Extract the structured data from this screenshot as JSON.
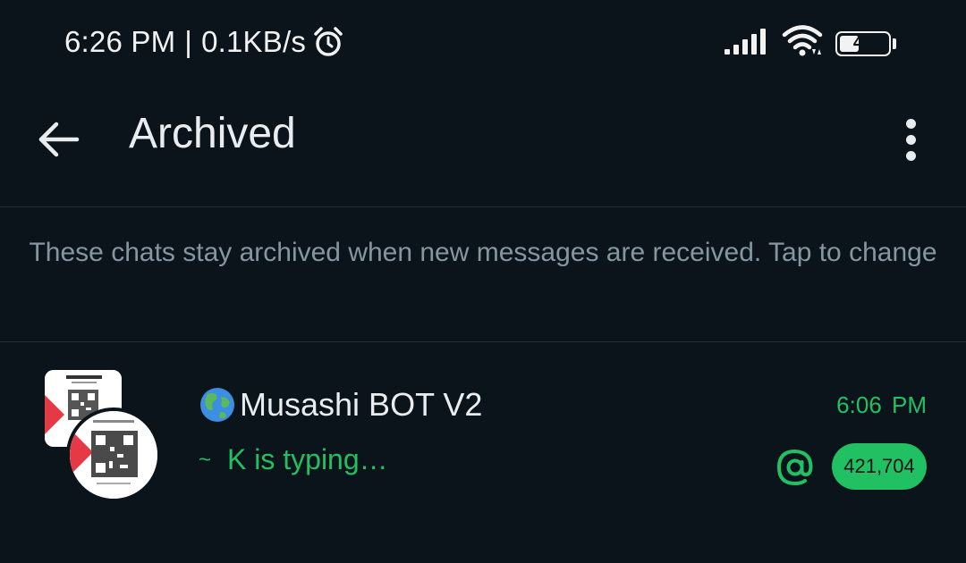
{
  "status_bar": {
    "time": "6:26 PM",
    "separator": "|",
    "network_speed": "0.1KB/s",
    "alarm_icon": "alarm-clock-icon",
    "signal_icon": "cell-signal-icon",
    "wifi_icon": "wifi-icon",
    "battery_level": "41",
    "battery_fraction": 0.41
  },
  "app_bar": {
    "back_icon": "arrow-back-icon",
    "title": "Archived",
    "menu_icon": "more-vertical-icon"
  },
  "info_banner": {
    "text": "These chats stay archived when new messages are received. Tap to change"
  },
  "chats": [
    {
      "name_emoji": "globe-icon",
      "name": "Musashi BOT V2",
      "preview_prefix": "~",
      "preview": "K is typing…",
      "time": "6:06 PM",
      "mention_icon": "at-mention-icon",
      "unread_count": "421,704"
    }
  ],
  "colors": {
    "background": "#0b141a",
    "accent_green": "#21c063",
    "muted_text": "#8696a0",
    "primary_text": "#e9edef",
    "divider": "#222d34"
  }
}
